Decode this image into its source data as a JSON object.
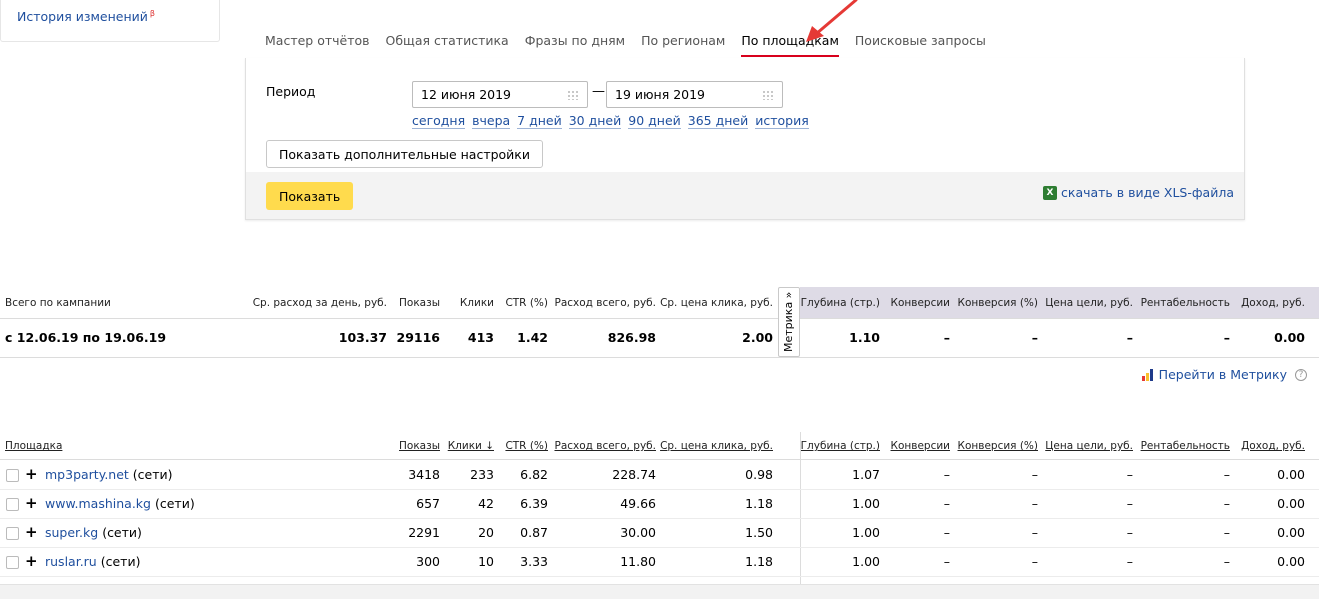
{
  "sidebar": {
    "history_label": "История изменений",
    "history_badge": "β"
  },
  "tabs": [
    {
      "label": "Мастер отчётов",
      "active": false
    },
    {
      "label": "Общая статистика",
      "active": false
    },
    {
      "label": "Фразы по дням",
      "active": false
    },
    {
      "label": "По регионам",
      "active": false
    },
    {
      "label": "По площадкам",
      "active": true
    },
    {
      "label": "Поисковые запросы",
      "active": false
    }
  ],
  "filters": {
    "period_label": "Период",
    "date_from": "12 июня 2019",
    "date_to": "19 июня 2019",
    "quick_ranges": [
      "сегодня",
      "вчера",
      "7 дней",
      "30 дней",
      "90 дней",
      "365 дней",
      "история"
    ],
    "more_settings_label": "Показать дополнительные настройки",
    "show_label": "Показать",
    "xls_label": "скачать в виде XLS-файла"
  },
  "summary": {
    "headers": [
      "Всего по кампании",
      "Ср. расход за день, руб.",
      "Показы",
      "Клики",
      "CTR (%)",
      "Расход всего, руб.",
      "Ср. цена клика, руб.",
      "Глубина (стр.)",
      "Конверсии",
      "Конверсия (%)",
      "Цена цели, руб.",
      "Рентабельность",
      "Доход, руб."
    ],
    "row": [
      "с 12.06.19 по 19.06.19",
      "103.37",
      "29116",
      "413",
      "1.42",
      "826.98",
      "2.00",
      "1.10",
      "–",
      "–",
      "–",
      "–",
      "0.00"
    ],
    "metrika_tab_label": "Метрика »",
    "goto_metrika_label": "Перейти в Метрику",
    "help_icon": "?"
  },
  "sites_table": {
    "headers": [
      "Площадка",
      "Показы",
      "Клики ↓",
      "CTR (%)",
      "Расход всего, руб.",
      "Ср. цена клика, руб.",
      "Глубина (стр.)",
      "Конверсии",
      "Конверсия (%)",
      "Цена цели, руб.",
      "Рентабельность",
      "Доход, руб."
    ],
    "rows": [
      {
        "site": "mp3party.net",
        "suffix": "(сети)",
        "values": [
          "3418",
          "233",
          "6.82",
          "228.74",
          "0.98",
          "1.07",
          "–",
          "–",
          "–",
          "–",
          "0.00"
        ]
      },
      {
        "site": "www.mashina.kg",
        "suffix": "(сети)",
        "values": [
          "657",
          "42",
          "6.39",
          "49.66",
          "1.18",
          "1.00",
          "–",
          "–",
          "–",
          "–",
          "0.00"
        ]
      },
      {
        "site": "super.kg",
        "suffix": "(сети)",
        "values": [
          "2291",
          "20",
          "0.87",
          "30.00",
          "1.50",
          "1.00",
          "–",
          "–",
          "–",
          "–",
          "0.00"
        ]
      },
      {
        "site": "ruslar.ru",
        "suffix": "(сети)",
        "values": [
          "300",
          "10",
          "3.33",
          "11.80",
          "1.18",
          "1.00",
          "–",
          "–",
          "–",
          "–",
          "0.00"
        ]
      }
    ]
  },
  "colors": {
    "link": "#1f4f9e",
    "active_tab": "#d8001c",
    "show_button": "#ffdb4d",
    "metrika_bg": "#dedbe6",
    "arrow": "#e53935"
  }
}
